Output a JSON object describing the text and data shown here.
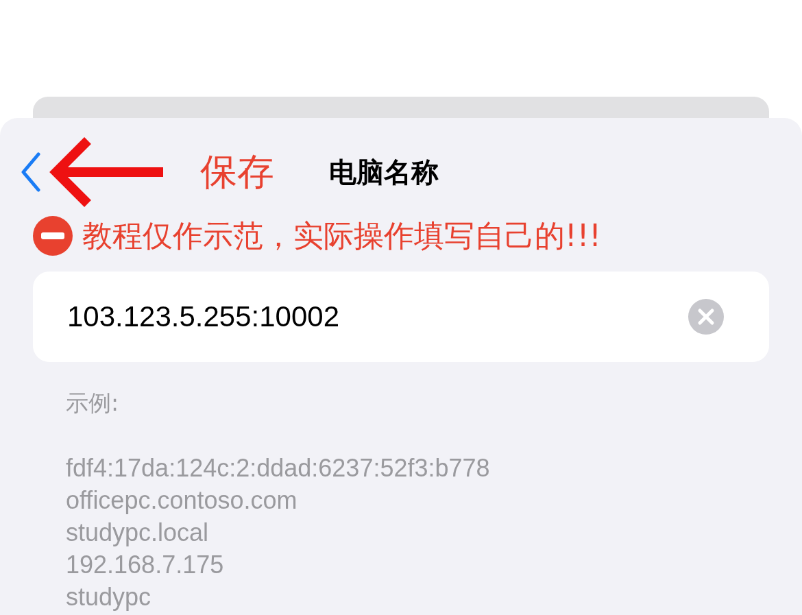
{
  "nav": {
    "annotation": "保存",
    "title": "电脑名称"
  },
  "warning": "教程仅作示范，实际操作填写自己的!!!",
  "field": {
    "value": "103.123.5.255:10002"
  },
  "hint": {
    "label": "示例:",
    "examples": [
      "fdf4:17da:124c:2:ddad:6237:52f3:b778",
      "officepc.contoso.com",
      "studypc.local",
      "192.168.7.175",
      "studypc"
    ]
  }
}
